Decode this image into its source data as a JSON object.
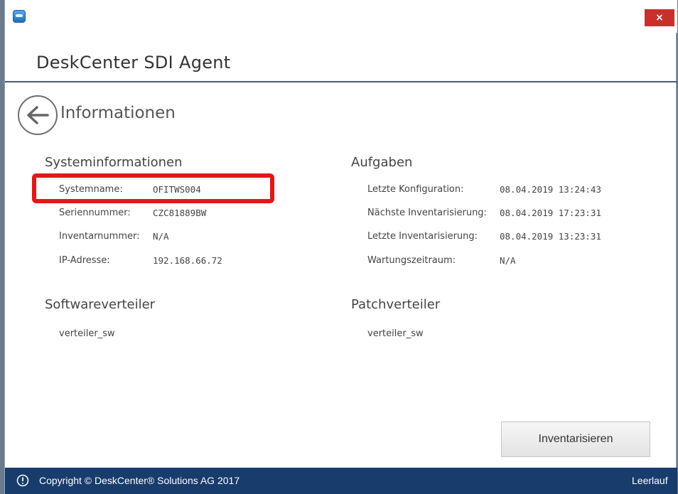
{
  "window": {
    "close_symbol": "×"
  },
  "header": {
    "app_title": "DeskCenter SDI Agent"
  },
  "page": {
    "title": "Informationen"
  },
  "system_info": {
    "title": "Systeminformationen",
    "rows": [
      {
        "label": "Systemname:",
        "value": "OFITWS004"
      },
      {
        "label": "Seriennummer:",
        "value": "CZC81889BW"
      },
      {
        "label": "Inventarnummer:",
        "value": "N/A"
      },
      {
        "label": "IP-Adresse:",
        "value": "192.168.66.72"
      }
    ]
  },
  "tasks": {
    "title": "Aufgaben",
    "rows": [
      {
        "label": "Letzte Konfiguration:",
        "value": "08.04.2019 13:24:43"
      },
      {
        "label": "Nächste Inventarisierung:",
        "value": "08.04.2019 17:23:31"
      },
      {
        "label": "Letzte Inventarisierung:",
        "value": "08.04.2019 13:23:31"
      },
      {
        "label": "Wartungszeitraum:",
        "value": "N/A"
      }
    ]
  },
  "software_distributor": {
    "title": "Softwareverteiler",
    "items": [
      "verteiler_sw"
    ]
  },
  "patch_distributor": {
    "title": "Patchverteiler",
    "items": [
      "verteiler_sw"
    ]
  },
  "actions": {
    "inventory_button": "Inventarisieren"
  },
  "footer": {
    "copyright": "Copyright © DeskCenter® Solutions AG 2017",
    "status": "Leerlauf"
  },
  "colors": {
    "accent_blue": "#183c6b",
    "highlight_red": "#e01818",
    "close_red": "#c9302c"
  }
}
